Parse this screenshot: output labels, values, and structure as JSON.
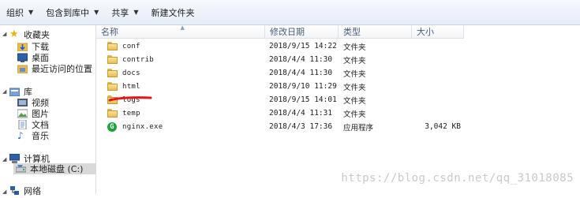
{
  "toolbar": {
    "organize": "组织",
    "include_in_library": "包含到库中",
    "share": "共享",
    "new_folder": "新建文件夹"
  },
  "nav": {
    "favorites": "收藏夹",
    "downloads": "下载",
    "desktop": "桌面",
    "recent": "最近访问的位置",
    "libraries": "库",
    "videos": "视频",
    "pictures": "图片",
    "documents": "文档",
    "music": "音乐",
    "computer": "计算机",
    "local_disk": "本地磁盘 (C:)",
    "network": "网络"
  },
  "columns": {
    "name": "名称",
    "modified": "修改日期",
    "type": "类型",
    "size": "大小"
  },
  "files": [
    {
      "name": "conf",
      "modified": "2018/9/15 14:22",
      "type": "文件夹",
      "size": ""
    },
    {
      "name": "contrib",
      "modified": "2018/4/4 11:30",
      "type": "文件夹",
      "size": ""
    },
    {
      "name": "docs",
      "modified": "2018/4/4 11:30",
      "type": "文件夹",
      "size": ""
    },
    {
      "name": "html",
      "modified": "2018/9/10 11:29",
      "type": "文件夹",
      "size": ""
    },
    {
      "name": "logs",
      "modified": "2018/9/15 14:01",
      "type": "文件夹",
      "size": ""
    },
    {
      "name": "temp",
      "modified": "2018/4/4 11:31",
      "type": "文件夹",
      "size": ""
    },
    {
      "name": "nginx.exe",
      "modified": "2018/4/3 17:36",
      "type": "应用程序",
      "size": "3,042 KB"
    }
  ],
  "watermark": "https://blog.csdn.net/qq_31018085",
  "colors": {
    "annotation": "#e8141a",
    "exe_icon": "#1aa33a"
  }
}
